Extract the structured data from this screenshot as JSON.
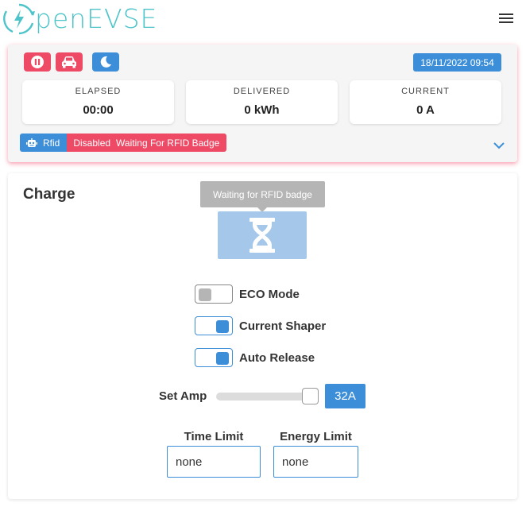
{
  "header": {
    "logo_text": "penEVSE",
    "colors": {
      "logo": "#4cc4c9"
    }
  },
  "status": {
    "datetime": "18/11/2022 09:54",
    "buttons": [
      {
        "icon": "pause-icon"
      },
      {
        "icon": "car-icon"
      },
      {
        "icon": "moon-icon"
      }
    ],
    "stats": {
      "elapsed": {
        "label": "ELAPSED",
        "value": "00:00"
      },
      "delivered": {
        "label": "DELIVERED",
        "value": "0 kWh"
      },
      "current": {
        "label": "CURRENT",
        "value": "0 A"
      }
    },
    "rfid": {
      "label": "Rfid",
      "state": "Disabled",
      "message": "Waiting For RFID Badge"
    },
    "colors": {
      "red": "#ee4a66",
      "blue": "#3d8ed8"
    }
  },
  "charge": {
    "title": "Charge",
    "tooltip": "Waiting for RFID badge",
    "toggles": [
      {
        "label": "ECO Mode",
        "on": false
      },
      {
        "label": "Current Shaper",
        "on": true
      },
      {
        "label": "Auto Release",
        "on": true
      }
    ],
    "set_amp": {
      "label": "Set Amp",
      "value": "32A",
      "level_fraction": 1.0
    },
    "time_limit": {
      "label": "Time Limit",
      "value": "none"
    },
    "energy_limit": {
      "label": "Energy Limit",
      "value": "none"
    }
  }
}
